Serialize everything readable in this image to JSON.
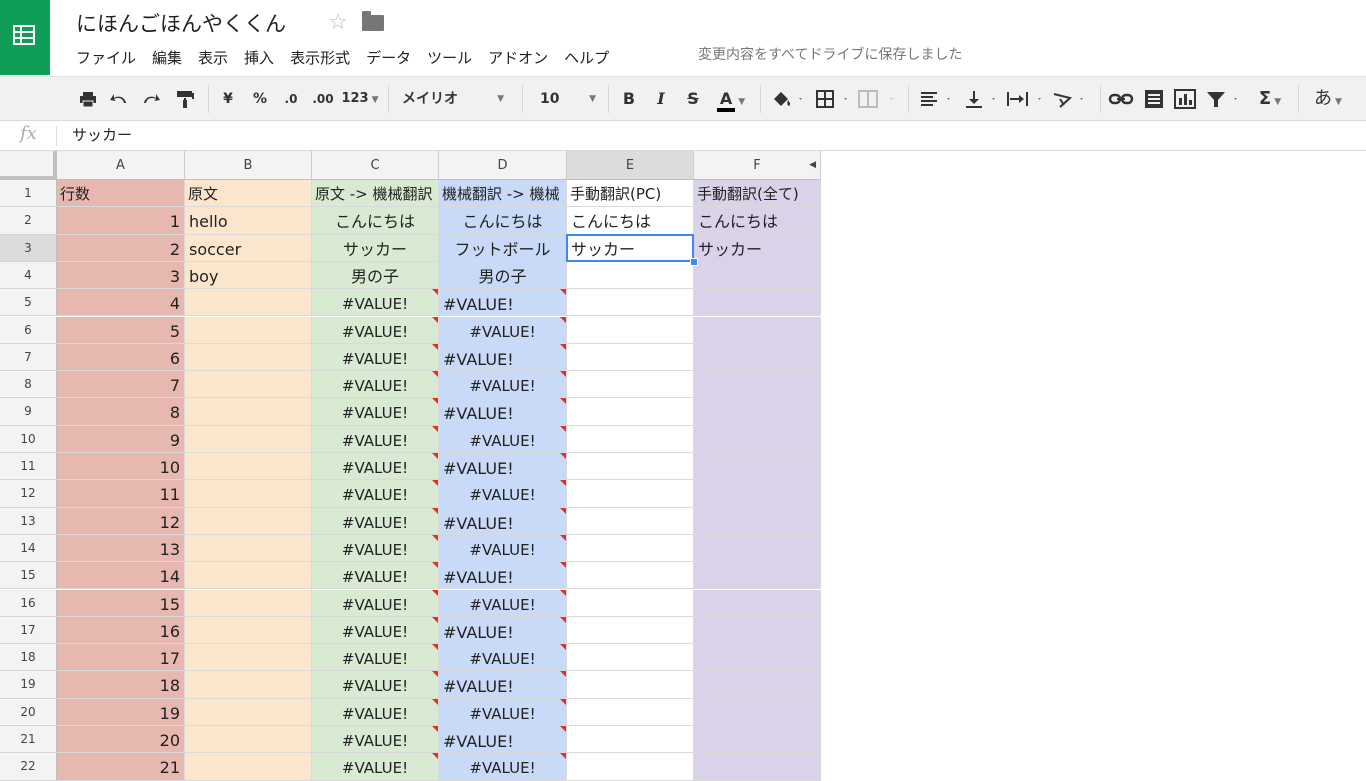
{
  "header": {
    "doc_title": "にほんごほんやくくん",
    "save_status": "変更内容をすべてドライブに保存しました",
    "menu": [
      "ファイル",
      "編集",
      "表示",
      "挿入",
      "表示形式",
      "データ",
      "ツール",
      "アドオン",
      "ヘルプ"
    ]
  },
  "toolbar": {
    "currency": "¥",
    "percent": "%",
    "decrease_decimal": ".0",
    "increase_decimal": ".00",
    "number_format": "123",
    "font_family": "メイリオ",
    "font_size": "10",
    "bold": "B",
    "italic": "I",
    "strike": "S",
    "text_color": "A",
    "sum": "Σ",
    "input_tools": "あ"
  },
  "formula_bar": {
    "fx": "fx",
    "value": "サッカー"
  },
  "columns": [
    "A",
    "B",
    "C",
    "D",
    "E",
    "F"
  ],
  "selected_column": "E",
  "selected_row": 3,
  "header_row": [
    "行数",
    "原文",
    "原文 -> 機械翻訳",
    "機械翻訳 -> 機械",
    "手動翻訳(PC)",
    "手動翻訳(全て)"
  ],
  "rows": [
    {
      "n": "2",
      "a": "1",
      "b": "hello",
      "c": "こんにちは",
      "d": "こんにちは",
      "e": "こんにちは",
      "f": "こんにちは"
    },
    {
      "n": "3",
      "a": "2",
      "b": "soccer",
      "c": "サッカー",
      "d": "フットボール",
      "e": "サッカー",
      "f": "サッカー"
    },
    {
      "n": "4",
      "a": "3",
      "b": "boy",
      "c": "男の子",
      "d": "男の子",
      "e": "",
      "f": ""
    },
    {
      "n": "5",
      "a": "4",
      "b": "",
      "c": "#VALUE!",
      "d": "#VALUE!",
      "e": "",
      "f": ""
    },
    {
      "n": "6",
      "a": "5",
      "b": "",
      "c": "#VALUE!",
      "d": "#VALUE!",
      "e": "",
      "f": ""
    },
    {
      "n": "7",
      "a": "6",
      "b": "",
      "c": "#VALUE!",
      "d": "#VALUE!",
      "e": "",
      "f": ""
    },
    {
      "n": "8",
      "a": "7",
      "b": "",
      "c": "#VALUE!",
      "d": "#VALUE!",
      "e": "",
      "f": ""
    },
    {
      "n": "9",
      "a": "8",
      "b": "",
      "c": "#VALUE!",
      "d": "#VALUE!",
      "e": "",
      "f": ""
    },
    {
      "n": "10",
      "a": "9",
      "b": "",
      "c": "#VALUE!",
      "d": "#VALUE!",
      "e": "",
      "f": ""
    },
    {
      "n": "11",
      "a": "10",
      "b": "",
      "c": "#VALUE!",
      "d": "#VALUE!",
      "e": "",
      "f": ""
    },
    {
      "n": "12",
      "a": "11",
      "b": "",
      "c": "#VALUE!",
      "d": "#VALUE!",
      "e": "",
      "f": ""
    },
    {
      "n": "13",
      "a": "12",
      "b": "",
      "c": "#VALUE!",
      "d": "#VALUE!",
      "e": "",
      "f": ""
    },
    {
      "n": "14",
      "a": "13",
      "b": "",
      "c": "#VALUE!",
      "d": "#VALUE!",
      "e": "",
      "f": ""
    },
    {
      "n": "15",
      "a": "14",
      "b": "",
      "c": "#VALUE!",
      "d": "#VALUE!",
      "e": "",
      "f": ""
    },
    {
      "n": "16",
      "a": "15",
      "b": "",
      "c": "#VALUE!",
      "d": "#VALUE!",
      "e": "",
      "f": ""
    },
    {
      "n": "17",
      "a": "16",
      "b": "",
      "c": "#VALUE!",
      "d": "#VALUE!",
      "e": "",
      "f": ""
    },
    {
      "n": "18",
      "a": "17",
      "b": "",
      "c": "#VALUE!",
      "d": "#VALUE!",
      "e": "",
      "f": ""
    },
    {
      "n": "19",
      "a": "18",
      "b": "",
      "c": "#VALUE!",
      "d": "#VALUE!",
      "e": "",
      "f": ""
    },
    {
      "n": "20",
      "a": "19",
      "b": "",
      "c": "#VALUE!",
      "d": "#VALUE!",
      "e": "",
      "f": ""
    },
    {
      "n": "21",
      "a": "20",
      "b": "",
      "c": "#VALUE!",
      "d": "#VALUE!",
      "e": "",
      "f": ""
    },
    {
      "n": "22",
      "a": "21",
      "b": "",
      "c": "#VALUE!",
      "d": "#VALUE!",
      "e": "",
      "f": ""
    }
  ],
  "colors": {
    "brand": "#0f9d58",
    "col_a": "#e6b8af",
    "col_b": "#fce5cd",
    "col_c": "#d9ead3",
    "col_d": "#c9daf8",
    "col_f": "#d9d2e9",
    "selection": "#4285f4",
    "error_marker": "#e0301e"
  }
}
